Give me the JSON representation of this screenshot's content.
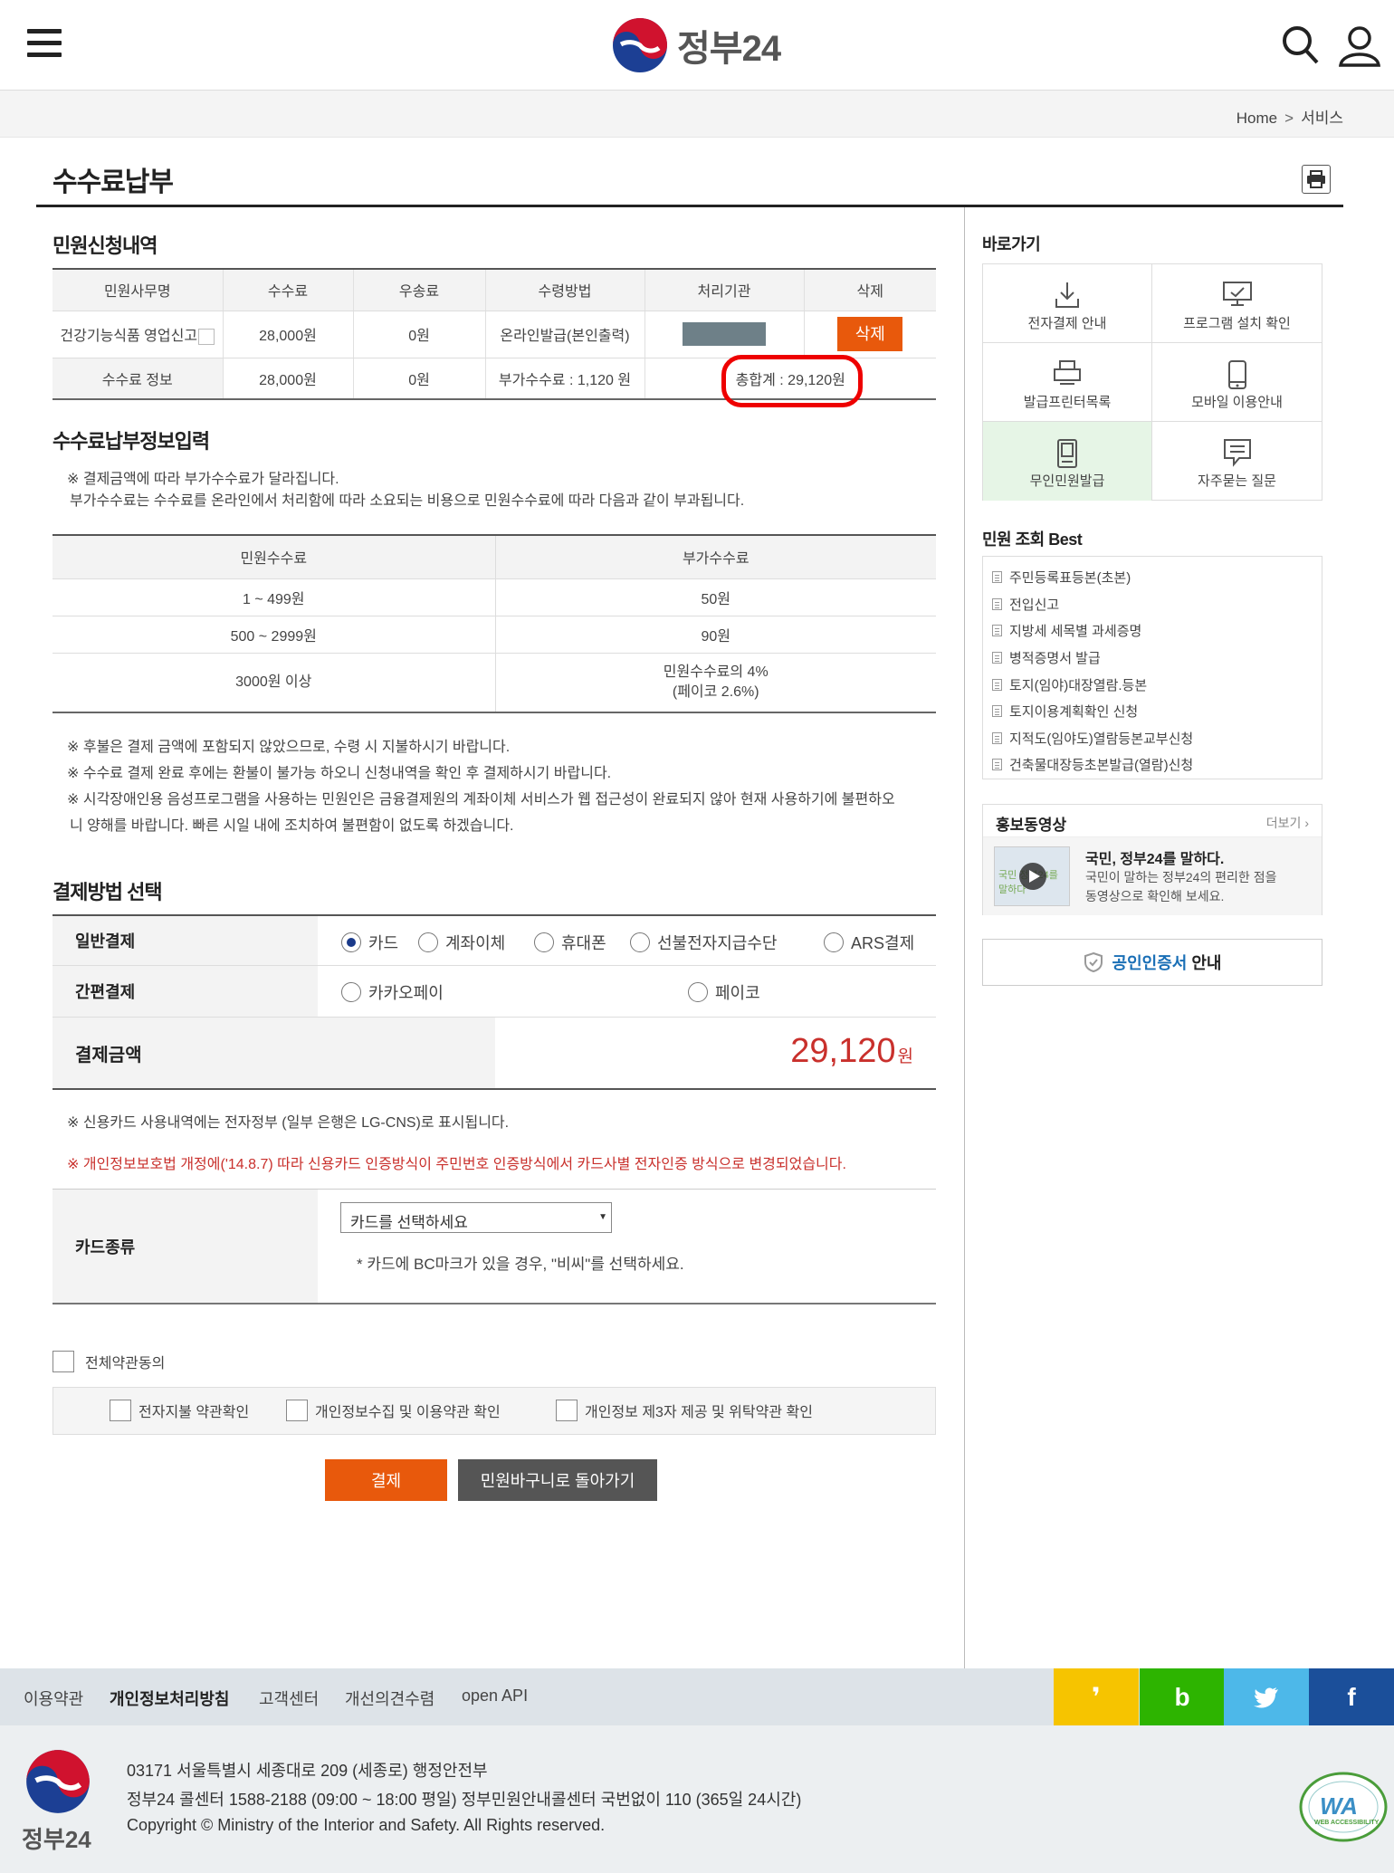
{
  "header": {
    "logo_text": "정부24"
  },
  "breadcrumb": {
    "home": "Home",
    "current": "서비스"
  },
  "page": {
    "title": "수수료납부"
  },
  "application": {
    "title": "민원신청내역",
    "columns": [
      "민원사무명",
      "수수료",
      "우송료",
      "수령방법",
      "처리기관",
      "삭제"
    ],
    "row": {
      "name": "건강기능식품 영업신고",
      "fee": "28,000원",
      "shipping": "0원",
      "method": "온라인발급(본인출력)",
      "delete_label": "삭제"
    },
    "fee_info": {
      "label": "수수료 정보",
      "fee": "28,000원",
      "shipping": "0원",
      "extra": "부가수수료 : 1,120 원",
      "total": "총합계 : 29,120원"
    }
  },
  "input_section": {
    "title": "수수료납부정보입력",
    "note1": "※ 결제금액에 따라 부가수수료가 달라집니다.",
    "note2": "부가수수료는 수수료를 온라인에서 처리함에 따라 소요되는 비용으로 민원수수료에 따라 다음과 같이 부과됩니다.",
    "columns": [
      "민원수수료",
      "부가수수료"
    ],
    "rows": [
      {
        "range": "1 ~ 499원",
        "extra": "50원"
      },
      {
        "range": "500 ~ 2999원",
        "extra": "90원"
      },
      {
        "range": "3000원 이상",
        "extra": "민원수수료의 4%",
        "extra2": "(페이코 2.6%)"
      }
    ],
    "notes": [
      "※ 후불은 결제 금액에 포함되지 않았으므로, 수령 시 지불하시기 바랍니다.",
      "※ 수수료 결제 완료 후에는 환불이 불가능 하오니 신청내역을 확인 후 결제하시기 바랍니다.",
      "※ 시각장애인용 음성프로그램을 사용하는 민원인은 금융결제원의 계좌이체 서비스가 웹 접근성이 완료되지 않아 현재 사용하기에 불편하오",
      "니 양해를 바랍니다. 빠른 시일 내에 조치하여 불편함이 없도록 하겠습니다."
    ]
  },
  "payment": {
    "title": "결제방법 선택",
    "general_label": "일반결제",
    "general_options": [
      "카드",
      "계좌이체",
      "휴대폰",
      "선불전자지급수단",
      "ARS결제"
    ],
    "simple_label": "간편결제",
    "simple_options": [
      "카카오페이",
      "페이코"
    ],
    "amount_label": "결제금액",
    "amount": "29,120",
    "amount_unit": "원",
    "card_note": "※ 신용카드 사용내역에는 전자정부 (일부 은행은 LG-CNS)로 표시됩니다.",
    "red_note": "※ 개인정보보호법 개정에('14.8.7) 따라 신용카드 인증방식이 주민번호 인증방식에서 카드사별 전자인증 방식으로 변경되었습니다.",
    "card_type_label": "카드종류",
    "card_select": "카드를 선택하세요",
    "card_hint": "* 카드에 BC마크가 있을 경우, \"비씨\"를 선택하세요."
  },
  "agreement": {
    "all": "전체약관동의",
    "items": [
      "전자지불 약관확인",
      "개인정보수집 및 이용약관 확인",
      "개인정보 제3자 제공 및 위탁약관 확인"
    ]
  },
  "buttons": {
    "pay": "결제",
    "back": "민원바구니로 돌아가기"
  },
  "sidebar": {
    "quick_title": "바로가기",
    "quick": [
      "전자결제 안내",
      "프로그램 설치 확인",
      "발급프린터목록",
      "모바일 이용안내",
      "무인민원발급",
      "자주묻는 질문"
    ],
    "best_title": "민원 조회 Best",
    "best": [
      "주민등록표등본(초본)",
      "전입신고",
      "지방세 세목별 과세증명",
      "병적증명서 발급",
      "토지(임야)대장열람.등본",
      "토지이용계획확인 신청",
      "지적도(임야도)열람등본교부신청",
      "건축물대장등초본발급(열람)신청"
    ],
    "promo_title": "홍보동영상",
    "promo_more": "더보기",
    "promo_head": "국민, 정부24를 말하다.",
    "promo_desc1": "국민이 말하는 정부24의 편리한 점을",
    "promo_desc2": "동영상으로 확인해 보세요.",
    "promo_thumb": "국민 정부24를 말하다",
    "cert_a": "공인인증서",
    "cert_b": " 안내"
  },
  "footer": {
    "links": [
      "이용약관",
      "개인정보처리방침",
      "고객센터",
      "개선의견수렴",
      "open API"
    ],
    "address": "03171 서울특별시 세종대로 209 (세종로) 행정안전부",
    "call": "정부24 콜센터 1588-2188 (09:00 ~ 18:00 평일) 정부민원안내콜센터 국번없이 110 (365일 24시간)",
    "copyright": "Copyright © Ministry of the Interior and Safety. All Rights reserved.",
    "logo_text": "정부24",
    "wa_text": "WA",
    "wa_sub": "WEB ACCESSIBILITY",
    "sns": [
      "kakao",
      "blog",
      "twitter",
      "facebook"
    ]
  },
  "colors": {
    "accent": "#e8590c",
    "amount_red": "#c9302c",
    "dark_button": "#555555"
  }
}
